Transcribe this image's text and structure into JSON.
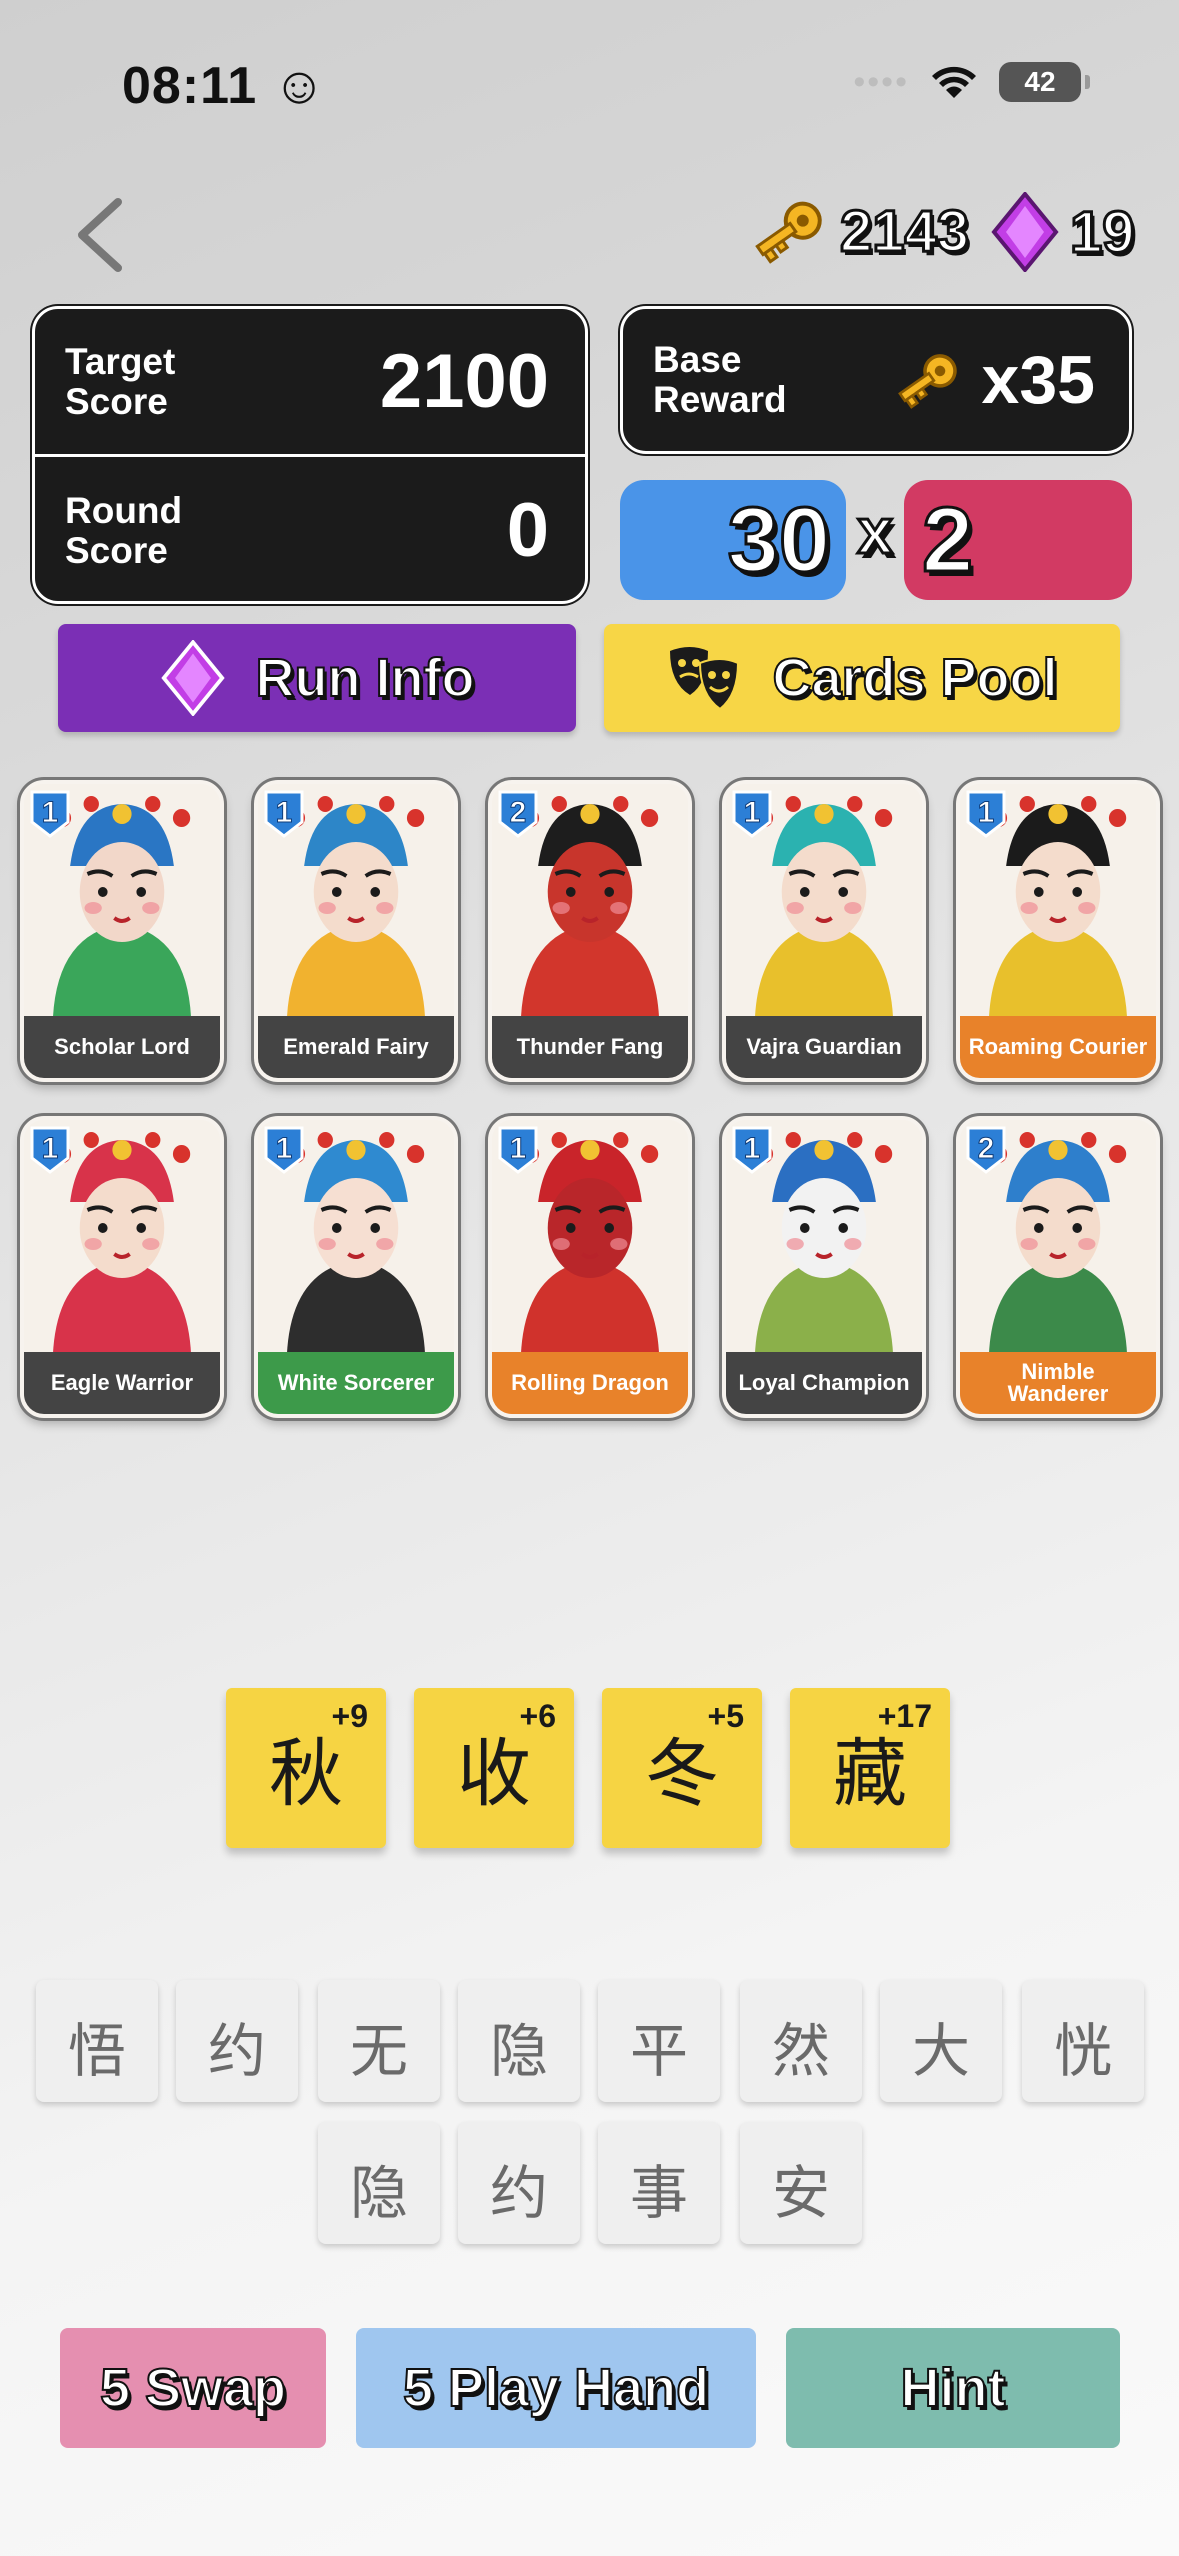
{
  "status_bar": {
    "time": "08:11",
    "time_emoji": "☺",
    "battery": "42"
  },
  "currency": {
    "keys": "2143",
    "gems": "19"
  },
  "scores": {
    "target_label_1": "Target",
    "target_label_2": "Score",
    "target_value": "2100",
    "round_label_1": "Round",
    "round_label_2": "Score",
    "round_value": "0"
  },
  "reward": {
    "label_1": "Base",
    "label_2": "Reward",
    "value": "x35"
  },
  "calc": {
    "chips": "30",
    "times": "x",
    "mult": "2"
  },
  "buttons": {
    "run_info": "Run Info",
    "cards_pool": "Cards Pool",
    "swap": "5 Swap",
    "play_hand": "5 Play Hand",
    "hint": "Hint"
  },
  "cards": [
    {
      "name": "Scholar Lord",
      "level": "1",
      "plate": "#444444",
      "face": "#f2d7c9",
      "crown": "#2a76c4",
      "robe": "#3aa65a"
    },
    {
      "name": "Emerald Fairy",
      "level": "1",
      "plate": "#444444",
      "face": "#f4dccc",
      "crown": "#2d86c8",
      "robe": "#f1b22f"
    },
    {
      "name": "Thunder Fang",
      "level": "2",
      "plate": "#444444",
      "face": "#c8352c",
      "crown": "#1d1d1d",
      "robe": "#d2362c"
    },
    {
      "name": "Vajra Guardian",
      "level": "1",
      "plate": "#444444",
      "face": "#f4dccc",
      "crown": "#2bb2b0",
      "robe": "#e8c02c"
    },
    {
      "name": "Roaming Courier",
      "level": "1",
      "plate": "#e8822a",
      "face": "#f4dccc",
      "crown": "#1b1b1b",
      "robe": "#e8c02c"
    },
    {
      "name": "Eagle Warrior",
      "level": "1",
      "plate": "#444444",
      "face": "#f4dccc",
      "crown": "#d8334a",
      "robe": "#d8334a"
    },
    {
      "name": "White Sorcerer",
      "level": "1",
      "plate": "#3d9a4a",
      "face": "#f6dfd2",
      "crown": "#2f8ad0",
      "robe": "#2d2d2d"
    },
    {
      "name": "Rolling Dragon",
      "level": "1",
      "plate": "#e8822a",
      "face": "#b9262a",
      "crown": "#c9242a",
      "robe": "#d0322c"
    },
    {
      "name": "Loyal Champion",
      "level": "1",
      "plate": "#444444",
      "face": "#f2f2f2",
      "crown": "#2b6fc2",
      "robe": "#8bb04a"
    },
    {
      "name": "Nimble Wanderer",
      "level": "2",
      "plate": "#e8822a",
      "face": "#f4dccc",
      "crown": "#2e7fcc",
      "robe": "#3c8a4a"
    }
  ],
  "selected_tiles": [
    {
      "char": "秋",
      "bonus": "+9"
    },
    {
      "char": "收",
      "bonus": "+6"
    },
    {
      "char": "冬",
      "bonus": "+5"
    },
    {
      "char": "藏",
      "bonus": "+17"
    }
  ],
  "hand_tiles": [
    "悟",
    "约",
    "无",
    "隐",
    "平",
    "然",
    "大",
    "恍",
    "隐",
    "约",
    "事",
    "安"
  ]
}
